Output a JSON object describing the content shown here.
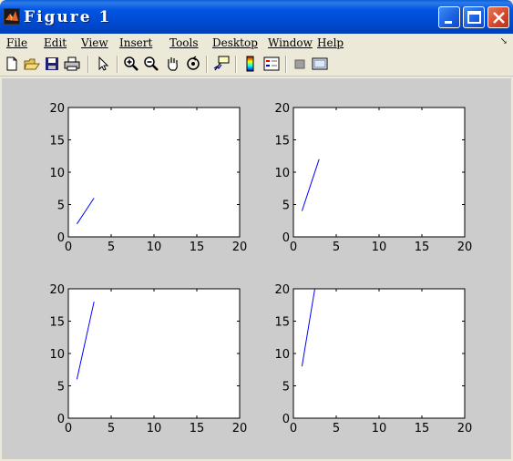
{
  "window": {
    "title": "Figure 1",
    "controls": [
      "minimize",
      "maximize",
      "close"
    ]
  },
  "menubar": {
    "items": [
      {
        "label": "File"
      },
      {
        "label": "Edit"
      },
      {
        "label": "View"
      },
      {
        "label": "Insert"
      },
      {
        "label": "Tools"
      },
      {
        "label": "Desktop"
      },
      {
        "label": "Window"
      },
      {
        "label": "Help"
      }
    ]
  },
  "toolbar": {
    "icons": [
      "new-figure-icon",
      "open-file-icon",
      "save-icon",
      "print-icon",
      "edit-plot-arrow-icon",
      "zoom-in-icon",
      "zoom-out-icon",
      "pan-hand-icon",
      "rotate-3d-icon",
      "data-cursor-icon",
      "insert-colorbar-icon",
      "insert-legend-icon",
      "hide-plot-tools-icon",
      "show-plot-tools-icon"
    ]
  },
  "colors": {
    "figure_background": "#cccccc",
    "axes_background": "#ffffff",
    "line": "#0000ff"
  },
  "chart_data": [
    {
      "type": "line",
      "xlim": [
        0,
        20
      ],
      "ylim": [
        0,
        20
      ],
      "xticks": [
        "0",
        "5",
        "10",
        "15",
        "20"
      ],
      "yticks": [
        "0",
        "5",
        "10",
        "15",
        "20"
      ],
      "series": [
        {
          "x": [
            1,
            2,
            3
          ],
          "y": [
            2,
            4,
            6
          ]
        }
      ]
    },
    {
      "type": "line",
      "xlim": [
        0,
        20
      ],
      "ylim": [
        0,
        20
      ],
      "xticks": [
        "0",
        "5",
        "10",
        "15",
        "20"
      ],
      "yticks": [
        "0",
        "5",
        "10",
        "15",
        "20"
      ],
      "series": [
        {
          "x": [
            1,
            2,
            3
          ],
          "y": [
            4,
            8,
            12
          ]
        }
      ]
    },
    {
      "type": "line",
      "xlim": [
        0,
        20
      ],
      "ylim": [
        0,
        20
      ],
      "xticks": [
        "0",
        "5",
        "10",
        "15",
        "20"
      ],
      "yticks": [
        "0",
        "5",
        "10",
        "15",
        "20"
      ],
      "series": [
        {
          "x": [
            1,
            2,
            3
          ],
          "y": [
            6,
            12,
            18
          ]
        }
      ]
    },
    {
      "type": "line",
      "xlim": [
        0,
        20
      ],
      "ylim": [
        0,
        20
      ],
      "xticks": [
        "0",
        "5",
        "10",
        "15",
        "20"
      ],
      "yticks": [
        "0",
        "5",
        "10",
        "15",
        "20"
      ],
      "series": [
        {
          "x": [
            1,
            2,
            3
          ],
          "y": [
            8,
            16,
            24
          ]
        }
      ]
    }
  ]
}
